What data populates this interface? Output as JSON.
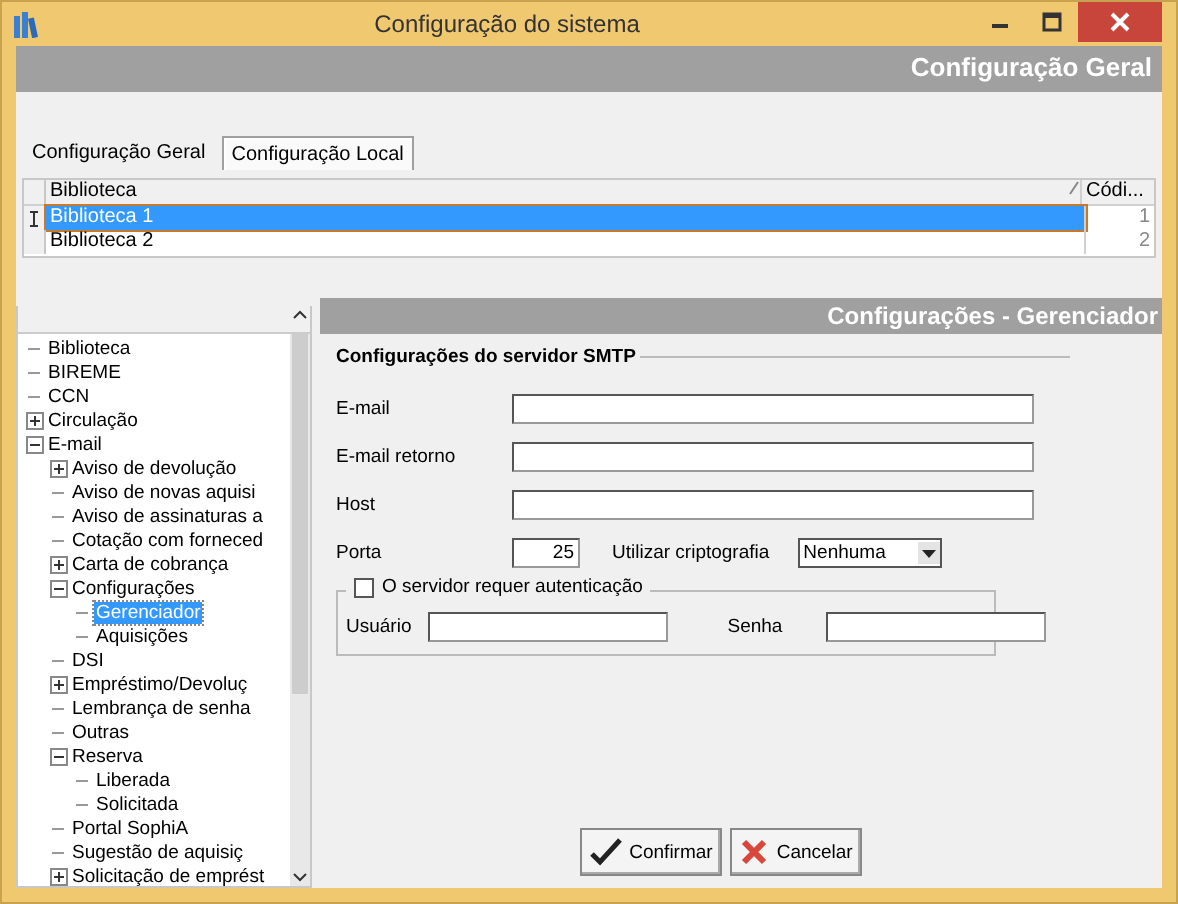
{
  "window": {
    "title": "Configuração do sistema"
  },
  "header": {
    "title": "Configuração Geral"
  },
  "tabs": [
    {
      "label": "Configuração Geral",
      "selected": false
    },
    {
      "label": "Configuração Local",
      "selected": true
    }
  ],
  "table": {
    "columns": [
      "Biblioteca",
      "Códi..."
    ],
    "rows": [
      {
        "cells": [
          "Biblioteca 1",
          "1"
        ],
        "selected": true
      },
      {
        "cells": [
          "Biblioteca 2",
          "2"
        ],
        "selected": false
      }
    ]
  },
  "tree": {
    "items": [
      {
        "label": "Biblioteca",
        "kind": "leaf",
        "selected": false
      },
      {
        "label": "BIREME",
        "kind": "leaf",
        "selected": false
      },
      {
        "label": "CCN",
        "kind": "leaf",
        "selected": false
      },
      {
        "label": "Circulação",
        "kind": "folder",
        "expanded": false,
        "selected": false
      },
      {
        "label": "E-mail",
        "kind": "folder",
        "expanded": true,
        "selected": false,
        "children": [
          {
            "label": "Aviso de devolução",
            "kind": "folder",
            "expanded": false,
            "selected": false
          },
          {
            "label": "Aviso de novas aquisi",
            "kind": "leaf",
            "selected": false
          },
          {
            "label": "Aviso de assinaturas a",
            "kind": "leaf",
            "selected": false
          },
          {
            "label": "Cotação com forneced",
            "kind": "leaf",
            "selected": false
          },
          {
            "label": "Carta de cobrança",
            "kind": "folder",
            "expanded": false,
            "selected": false
          },
          {
            "label": "Configurações",
            "kind": "folder",
            "expanded": true,
            "selected": false,
            "children": [
              {
                "label": "Gerenciador",
                "kind": "leaf",
                "selected": true
              },
              {
                "label": "Aquisições",
                "kind": "leaf",
                "selected": false
              }
            ]
          },
          {
            "label": "DSI",
            "kind": "leaf",
            "selected": false
          },
          {
            "label": "Empréstimo/Devoluç",
            "kind": "folder",
            "expanded": false,
            "selected": false
          },
          {
            "label": "Lembrança de senha",
            "kind": "leaf",
            "selected": false
          },
          {
            "label": "Outras",
            "kind": "leaf",
            "selected": false
          },
          {
            "label": "Reserva",
            "kind": "folder",
            "expanded": true,
            "selected": false,
            "children": [
              {
                "label": "Liberada",
                "kind": "leaf",
                "selected": false
              },
              {
                "label": "Solicitada",
                "kind": "leaf",
                "selected": false
              }
            ]
          },
          {
            "label": "Portal SophiA",
            "kind": "leaf",
            "selected": false
          },
          {
            "label": "Sugestão de aquisiç",
            "kind": "leaf",
            "selected": false
          },
          {
            "label": "Solicitação de emprést",
            "kind": "folder",
            "expanded": false,
            "selected": false
          }
        ]
      }
    ]
  },
  "panel": {
    "title": "Configurações - Gerenciador",
    "group": "Configurações do servidor SMTP",
    "fields": [
      {
        "label": "E-mail"
      },
      {
        "label": "E-mail retorno"
      },
      {
        "label": "Host"
      }
    ],
    "port": {
      "label": "Porta",
      "value": "25"
    },
    "encryption": {
      "label": "Utilizar criptografia",
      "value": "Nenhuma"
    },
    "auth": {
      "label": "O servidor requer autenticação",
      "checked": false,
      "user_label": "Usuário",
      "password_label": "Senha"
    }
  },
  "buttons": [
    {
      "label": "Confirmar",
      "kind": "confirm"
    },
    {
      "label": "Cancelar",
      "kind": "cancel"
    }
  ]
}
